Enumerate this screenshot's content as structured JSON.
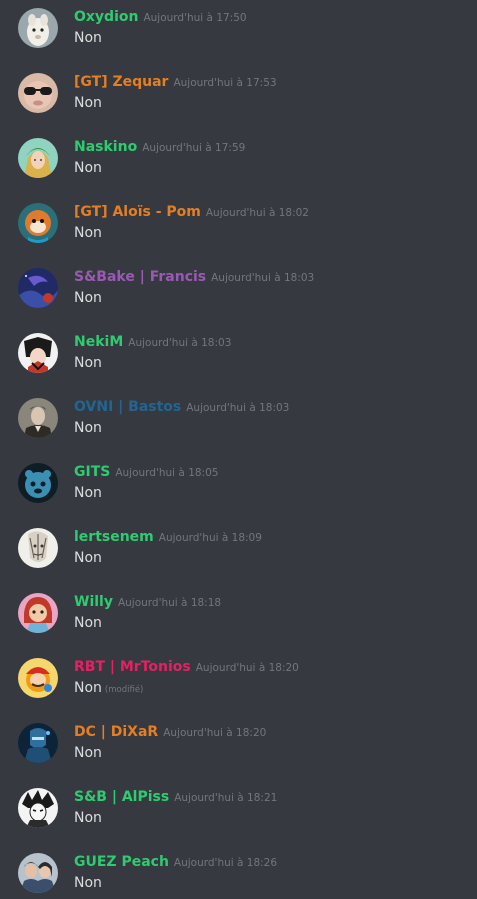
{
  "messages": [
    {
      "author": "Oxydion",
      "author_color": "#2ecc71",
      "timestamp": "Aujourd'hui à 17:50",
      "content": "Non",
      "avatar": "alpaca-avatar-icon"
    },
    {
      "author": "[GT] Zequar",
      "author_color": "#e67e22",
      "timestamp": "Aujourd'hui à 17:53",
      "content": "Non",
      "avatar": "sunglasses-face-avatar-icon"
    },
    {
      "author": "Naskino",
      "author_color": "#2ecc71",
      "timestamp": "Aujourd'hui à 17:59",
      "content": "Non",
      "avatar": "elf-hero-avatar-icon"
    },
    {
      "author": "[GT] Aloïs - Pom",
      "author_color": "#e67e22",
      "timestamp": "Aujourd'hui à 18:02",
      "content": "Non",
      "avatar": "cartoon-character-avatar-icon"
    },
    {
      "author": "S&Bake | Francis",
      "author_color": "#9b59b6",
      "timestamp": "Aujourd'hui à 18:03",
      "content": "Non",
      "avatar": "night-sky-avatar-icon"
    },
    {
      "author": "NekiM",
      "author_color": "#2ecc71",
      "timestamp": "Aujourd'hui à 18:03",
      "content": "Non",
      "avatar": "anime-character-avatar-icon"
    },
    {
      "author": "OVNI | Bastos",
      "author_color": "#206694",
      "timestamp": "Aujourd'hui à 18:03",
      "content": "Non",
      "avatar": "man-portrait-avatar-icon"
    },
    {
      "author": "GITS",
      "author_color": "#2ecc71",
      "timestamp": "Aujourd'hui à 18:05",
      "content": "Non",
      "avatar": "blue-creature-avatar-icon"
    },
    {
      "author": "lertsenem",
      "author_color": "#2ecc71",
      "timestamp": "Aujourd'hui à 18:09",
      "content": "Non",
      "avatar": "sketch-drawing-avatar-icon"
    },
    {
      "author": "Willy",
      "author_color": "#2ecc71",
      "timestamp": "Aujourd'hui à 18:18",
      "content": "Non",
      "avatar": "red-hair-cartoon-avatar-icon"
    },
    {
      "author": "RBT | MrTonios",
      "author_color": "#e91e63",
      "timestamp": "Aujourd'hui à 18:20",
      "content": "Non",
      "edited": "(modifié)",
      "avatar": "mario-avatar-icon"
    },
    {
      "author": "DC | DiXaR",
      "author_color": "#e67e22",
      "timestamp": "Aujourd'hui à 18:20",
      "content": "Non",
      "avatar": "armored-figure-avatar-icon"
    },
    {
      "author": "S&B | AlPiss",
      "author_color": "#2ecc71",
      "timestamp": "Aujourd'hui à 18:21",
      "content": "Non",
      "avatar": "manga-character-avatar-icon"
    },
    {
      "author": "GUEZ Peach",
      "author_color": "#2ecc71",
      "timestamp": "Aujourd'hui à 18:26",
      "content": "Non",
      "avatar": "couple-photo-avatar-icon"
    }
  ]
}
